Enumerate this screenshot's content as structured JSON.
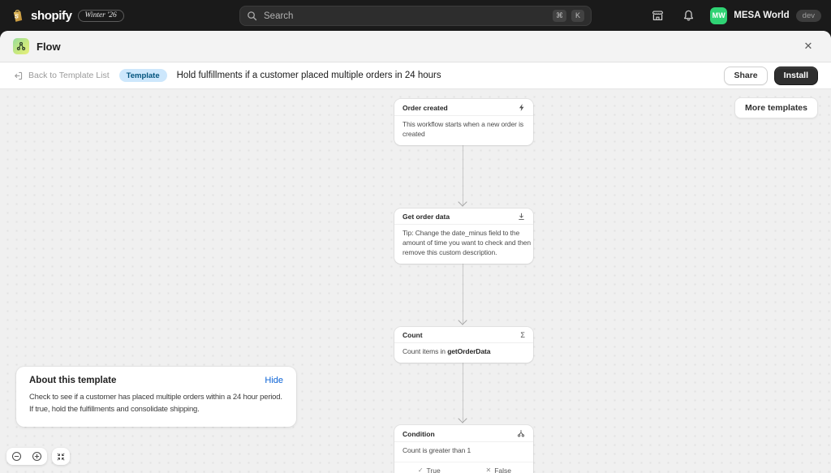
{
  "topbar": {
    "brand": "shopify",
    "edition_badge": "Winter '26",
    "search_placeholder": "Search",
    "shortcut_cmd": "⌘",
    "shortcut_k": "K",
    "store_initials": "MW",
    "store_name": "MESA World",
    "env_badge": "dev"
  },
  "app_header": {
    "title": "Flow",
    "close_glyph": "✕"
  },
  "toolbar": {
    "back_label": "Back to Template List",
    "template_badge": "Template",
    "title": "Hold fulfillments if a customer placed multiple orders in 24 hours",
    "share_label": "Share",
    "install_label": "Install"
  },
  "canvas": {
    "more_templates_label": "More templates",
    "nodes": [
      {
        "title": "Order created",
        "icon": "lightning-icon",
        "lines": [
          "This workflow starts when a new order is",
          "created"
        ]
      },
      {
        "title": "Get order data",
        "icon": "download-icon",
        "lines": [
          "Tip: Change the date_minus field to the",
          "amount of time you want to check and then",
          "remove this custom description."
        ]
      },
      {
        "title": "Count",
        "icon": "sigma-icon",
        "sigma_glyph": "Σ",
        "description_prefix": "Count items in ",
        "description_bold": "getOrderData"
      },
      {
        "title": "Condition",
        "icon": "branch-icon",
        "description": "Count is greater than 1",
        "true_glyph": "✓",
        "true_label": "True",
        "false_glyph": "✕",
        "false_label": "False"
      }
    ]
  },
  "about_card": {
    "title": "About this template",
    "hide_label": "Hide",
    "body_lines": [
      "Check to see if a customer has placed multiple orders within a 24 hour period.",
      "If true, hold the fulfillments and consolidate shipping."
    ]
  },
  "colors": {
    "topbar_bg": "#1a1a1a",
    "canvas_bg": "#f0f0f0",
    "accent_blue": "#0b63d6",
    "avatar_green": "#2fd374",
    "template_badge_bg": "#cde7fc",
    "template_badge_text": "#00527c",
    "install_btn_bg": "#2e2e2e"
  }
}
